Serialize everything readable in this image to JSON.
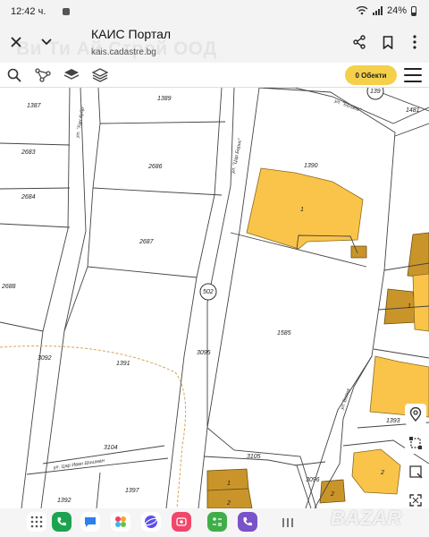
{
  "status_bar": {
    "time": "12:42 ч.",
    "battery": "24%"
  },
  "browser": {
    "watermark": "Ви Ти Ай Строй ООД",
    "page_title": "КАИС Портал",
    "url": "kais.cadastre.bg",
    "icons": {
      "close": "close-icon",
      "collapse": "chevron-down-icon",
      "share": "share-icon",
      "bookmark": "bookmark-icon",
      "more": "more-vertical-icon"
    }
  },
  "app_toolbar": {
    "objects_button": "0 Обекти",
    "accent_color": "#f5d04b",
    "icons": [
      "search-icon",
      "graph-icon",
      "layers-icon",
      "layers-outline-icon",
      "menu-icon"
    ]
  },
  "map": {
    "colors": {
      "building": "#f9c449",
      "building_dark": "#c9952a",
      "parcel_line": "#444444",
      "boundary_dashed": "#d9a35a"
    },
    "parcel_numbers": {
      "p1387": "1387",
      "p1389": "1389",
      "p139": "139",
      "p1481": "1481",
      "p1390": "1390",
      "p2683": "2683",
      "p2684": "2684",
      "p2686": "2686",
      "p2687": "2687",
      "p2688": "2688",
      "p502": "502",
      "p1585": "1585",
      "p3092": "3092",
      "p1391": "1391",
      "p3095": "3095",
      "p1393": "1393",
      "p3104": "3104",
      "p3105": "3105",
      "p3096": "3096",
      "p1392": "1392",
      "p1397": "1397"
    },
    "building_numbers": {
      "b1_main": "1",
      "b1_right": "1",
      "b1_bottom": "1",
      "b2_bottom": "2",
      "b2_right": "2",
      "b2_small": "2"
    },
    "streets": {
      "s1": "ул. \"Хан Кубр\"",
      "s2": "ул. \"Цар Борис\"",
      "s3": "ул. \"Беласи\"",
      "s4": "ул. Бояна",
      "s5": "ул. Цар Иван Шишман"
    }
  },
  "map_tools": [
    "location-pin-icon",
    "draw-polygon-icon",
    "select-area-icon",
    "fullscreen-icon"
  ],
  "nav": {
    "dock_apps": [
      "apps-grid-icon",
      "phone-icon",
      "messages-icon",
      "gallery-icon",
      "internet-icon",
      "screen-recorder-icon",
      "calculator-icon",
      "viber-icon"
    ],
    "buttons": [
      "recents-icon",
      "home-icon",
      "back-icon"
    ],
    "brand_watermark": "BAZAR"
  }
}
